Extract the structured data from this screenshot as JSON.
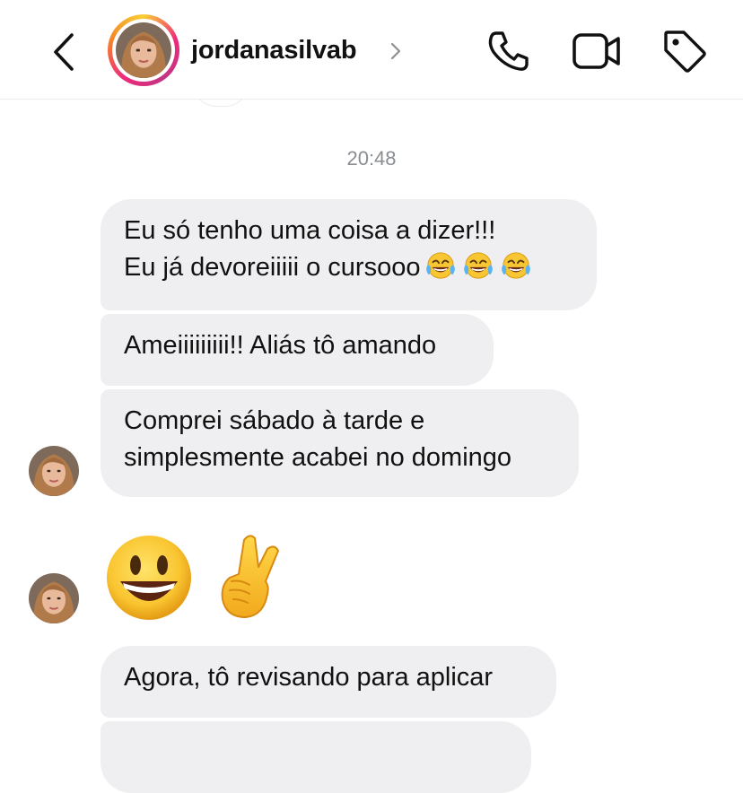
{
  "header": {
    "username": "jordanasilvab",
    "back_icon": "chevron-left-icon",
    "profile_chevron_icon": "chevron-right-icon",
    "actions": [
      "phone-icon",
      "video-camera-icon",
      "tag-icon"
    ]
  },
  "thread": {
    "timestamp": "20:48",
    "messages": [
      {
        "lines": [
          "Eu só tenho uma coisa a dizer!!!",
          "Eu já devoreiiiii o cursooo"
        ],
        "trailing_emoji": "face-with-tears-of-joy x3"
      },
      {
        "lines": [
          "Ameiiiiiiiii!! Aliás tô amando"
        ]
      },
      {
        "lines": [
          "Comprei sábado à tarde e",
          "simplesmente acabei no domingo"
        ]
      },
      {
        "emoji": [
          "smiling-face-with-open-mouth",
          "crossed-fingers"
        ]
      },
      {
        "lines": [
          "Agora, tô revisando para aplicar"
        ]
      }
    ]
  },
  "colors": {
    "bubble_bg": "#efeff1",
    "text": "#111111",
    "timestamp": "#8a8d91",
    "story_ring": [
      "#f9ce34",
      "#ee2a7b",
      "#c13584"
    ]
  }
}
